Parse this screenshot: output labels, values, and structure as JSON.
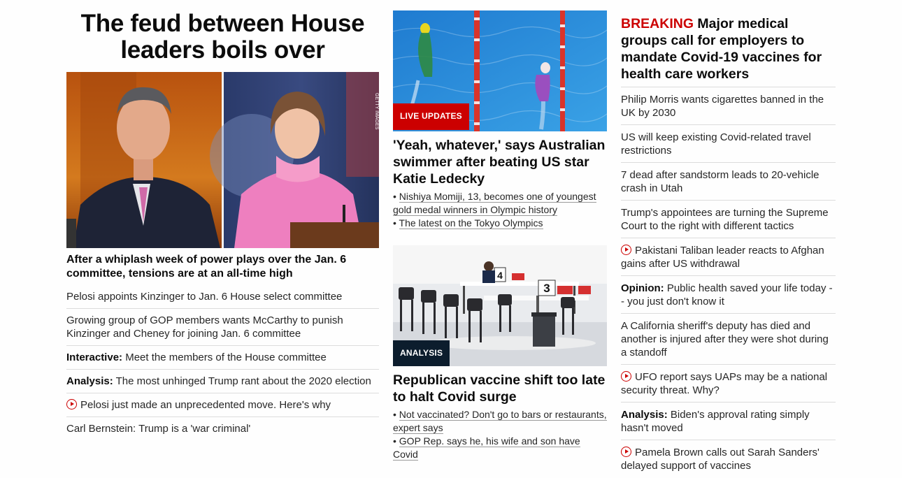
{
  "col1": {
    "headline": "The feud between House leaders boils over",
    "image_credit": "GETTY IMAGES",
    "subheadline": "After a whiplash week of power plays over the Jan. 6 committee, tensions are at an all-time high",
    "items": [
      {
        "prefix": "",
        "text": "Pelosi appoints Kinzinger to Jan. 6 House select committee",
        "video": false
      },
      {
        "prefix": "",
        "text": "Growing group of GOP members wants McCarthy to punish Kinzinger and Cheney for joining Jan. 6 committee",
        "video": false
      },
      {
        "prefix": "Interactive:",
        "text": " Meet the members of the House committee",
        "video": false
      },
      {
        "prefix": "Analysis:",
        "text": " The most unhinged Trump rant about the 2020 election",
        "video": false
      },
      {
        "prefix": "",
        "text": "Pelosi just made an unprecedented move. Here's why",
        "video": true
      },
      {
        "prefix": "",
        "text": "Carl Bernstein: Trump is a 'war criminal'",
        "video": false
      }
    ]
  },
  "col2": {
    "card1": {
      "badge": "LIVE UPDATES",
      "title": "'Yeah, whatever,' says Australian swimmer after beating US star Katie Ledecky",
      "links": [
        "Nishiya Momiji, 13, becomes one of youngest gold medal winners in Olympic history",
        "The latest on the Tokyo Olympics"
      ]
    },
    "card2": {
      "badge": "ANALYSIS",
      "title": "Republican vaccine shift too late to halt Covid surge",
      "links": [
        "Not vaccinated? Don't go to bars or restaurants, expert says",
        "GOP Rep. says he, his wife and son have Covid"
      ],
      "booth_numbers": [
        "4",
        "3"
      ]
    }
  },
  "col3": {
    "breaking_label": "BREAKING",
    "breaking_text": " Major medical groups call for employers to mandate Covid-19 vaccines for health care workers",
    "items": [
      {
        "prefix": "",
        "text": "Philip Morris wants cigarettes banned in the UK by 2030",
        "video": false
      },
      {
        "prefix": "",
        "text": "US will keep existing Covid-related travel restrictions",
        "video": false
      },
      {
        "prefix": "",
        "text": "7 dead after sandstorm leads to 20-vehicle crash in Utah",
        "video": false
      },
      {
        "prefix": "",
        "text": "Trump's appointees are turning the Supreme Court to the right with different tactics",
        "video": false
      },
      {
        "prefix": "",
        "text": "Pakistani Taliban leader reacts to Afghan gains after US withdrawal",
        "video": true
      },
      {
        "prefix": "Opinion:",
        "text": " Public health saved your life today -- you just don't know it",
        "video": false
      },
      {
        "prefix": "",
        "text": "A California sheriff's deputy has died and another is injured after they were shot during a standoff",
        "video": false
      },
      {
        "prefix": "",
        "text": "UFO report says UAPs may be a national security threat. Why?",
        "video": true
      },
      {
        "prefix": "Analysis:",
        "text": " Biden's approval rating simply hasn't moved",
        "video": false
      },
      {
        "prefix": "",
        "text": "Pamela Brown calls out Sarah Sanders' delayed support of vaccines",
        "video": true
      }
    ]
  },
  "colors": {
    "accent_red": "#cc0000",
    "badge_dark": "#0c1d2d",
    "text": "#262626"
  }
}
